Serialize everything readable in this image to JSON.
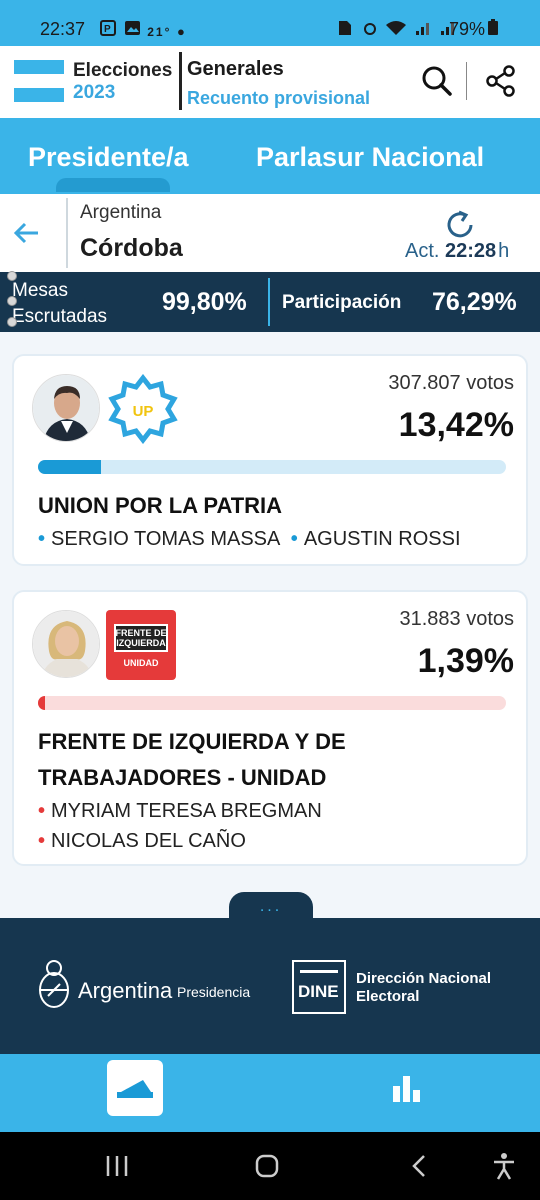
{
  "status_bar": {
    "time": "22:37",
    "temperature": "21°",
    "battery": "79%"
  },
  "header": {
    "logo_title": "Elecciones",
    "logo_year": "2023",
    "election_type": "Generales",
    "subtitle": "Recuento provisional"
  },
  "tabs": [
    {
      "label": "Presidente/a",
      "active": true
    },
    {
      "label": "Parlasur Nacional",
      "active": false
    }
  ],
  "region": {
    "country": "Argentina",
    "province": "Córdoba",
    "updated_prefix": "Act.",
    "updated_time": "22:28",
    "updated_suffix": "h"
  },
  "summary": {
    "mesas_label_line1": "Mesas",
    "mesas_label_line2": "Escrutadas",
    "mesas_value": "99,80%",
    "participation_label": "Participación",
    "participation_value": "76,29%"
  },
  "results": [
    {
      "votes": "307.807 votos",
      "percent": "13,42%",
      "percent_value": 13.42,
      "party_line1": "UNION POR LA PATRIA",
      "party_line2": "",
      "candidates_inline": [
        "SERGIO TOMAS MASSA",
        "AGUSTIN ROSSI"
      ],
      "party_logo_text": "UP",
      "color": "#1a9ad6",
      "track_color": "#d3ebf8"
    },
    {
      "votes": "31.883 votos",
      "percent": "1,39%",
      "percent_value": 1.39,
      "party_line1": "FRENTE DE IZQUIERDA Y DE",
      "party_line2": "TRABAJADORES - UNIDAD",
      "candidates": [
        "MYRIAM TERESA BREGMAN",
        "NICOLAS DEL CAÑO"
      ],
      "party_logo_line1": "FRENTE DE",
      "party_logo_line2": "IZQUIERDA",
      "party_logo_line3": "UNIDAD",
      "color": "#e53a3a",
      "track_color": "#fadcdc"
    }
  ],
  "more_button": "...",
  "footer": {
    "argentina": "Argentina",
    "presidencia": "Presidencia",
    "dine_abbr": "DINE",
    "dine_line1": "Dirección Nacional",
    "dine_line2": "Electoral"
  },
  "colors": {
    "primary": "#3ab4e8",
    "dark": "#16364f",
    "up": "#1a9ad6",
    "fit": "#e53a3a"
  },
  "icons": [
    "search-icon",
    "share-icon",
    "back-icon",
    "refresh-icon",
    "ballot-icon",
    "bar-chart-icon"
  ]
}
